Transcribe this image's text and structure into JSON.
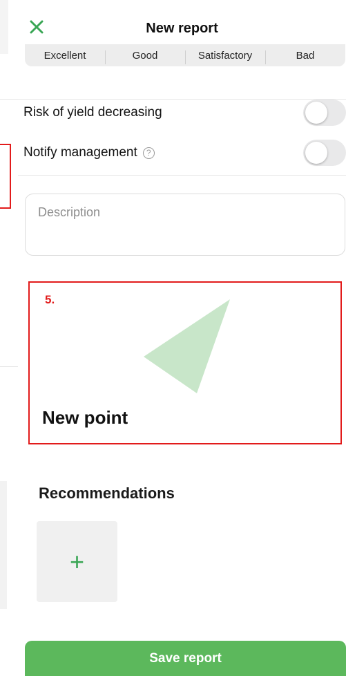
{
  "header": {
    "title": "New report",
    "close_icon": "close-x-icon",
    "accent_color": "#3aa655"
  },
  "rating": {
    "options": [
      "Excellent",
      "Good",
      "Satisfactory",
      "Bad"
    ]
  },
  "toggles": [
    {
      "label": "Risk of yield decreasing",
      "on": false
    },
    {
      "label": "Notify management",
      "on": false,
      "help_icon": "question-circle-icon"
    }
  ],
  "description": {
    "placeholder": "Description",
    "value": ""
  },
  "annotation": {
    "step": "5.",
    "highlight_color": "#e21b1b"
  },
  "point": {
    "title": "New point",
    "shape_color": "#c8e6c9"
  },
  "recommendations": {
    "title": "Recommendations",
    "add_symbol": "+"
  },
  "footer": {
    "save_label": "Save report",
    "save_color": "#5cb85c"
  }
}
